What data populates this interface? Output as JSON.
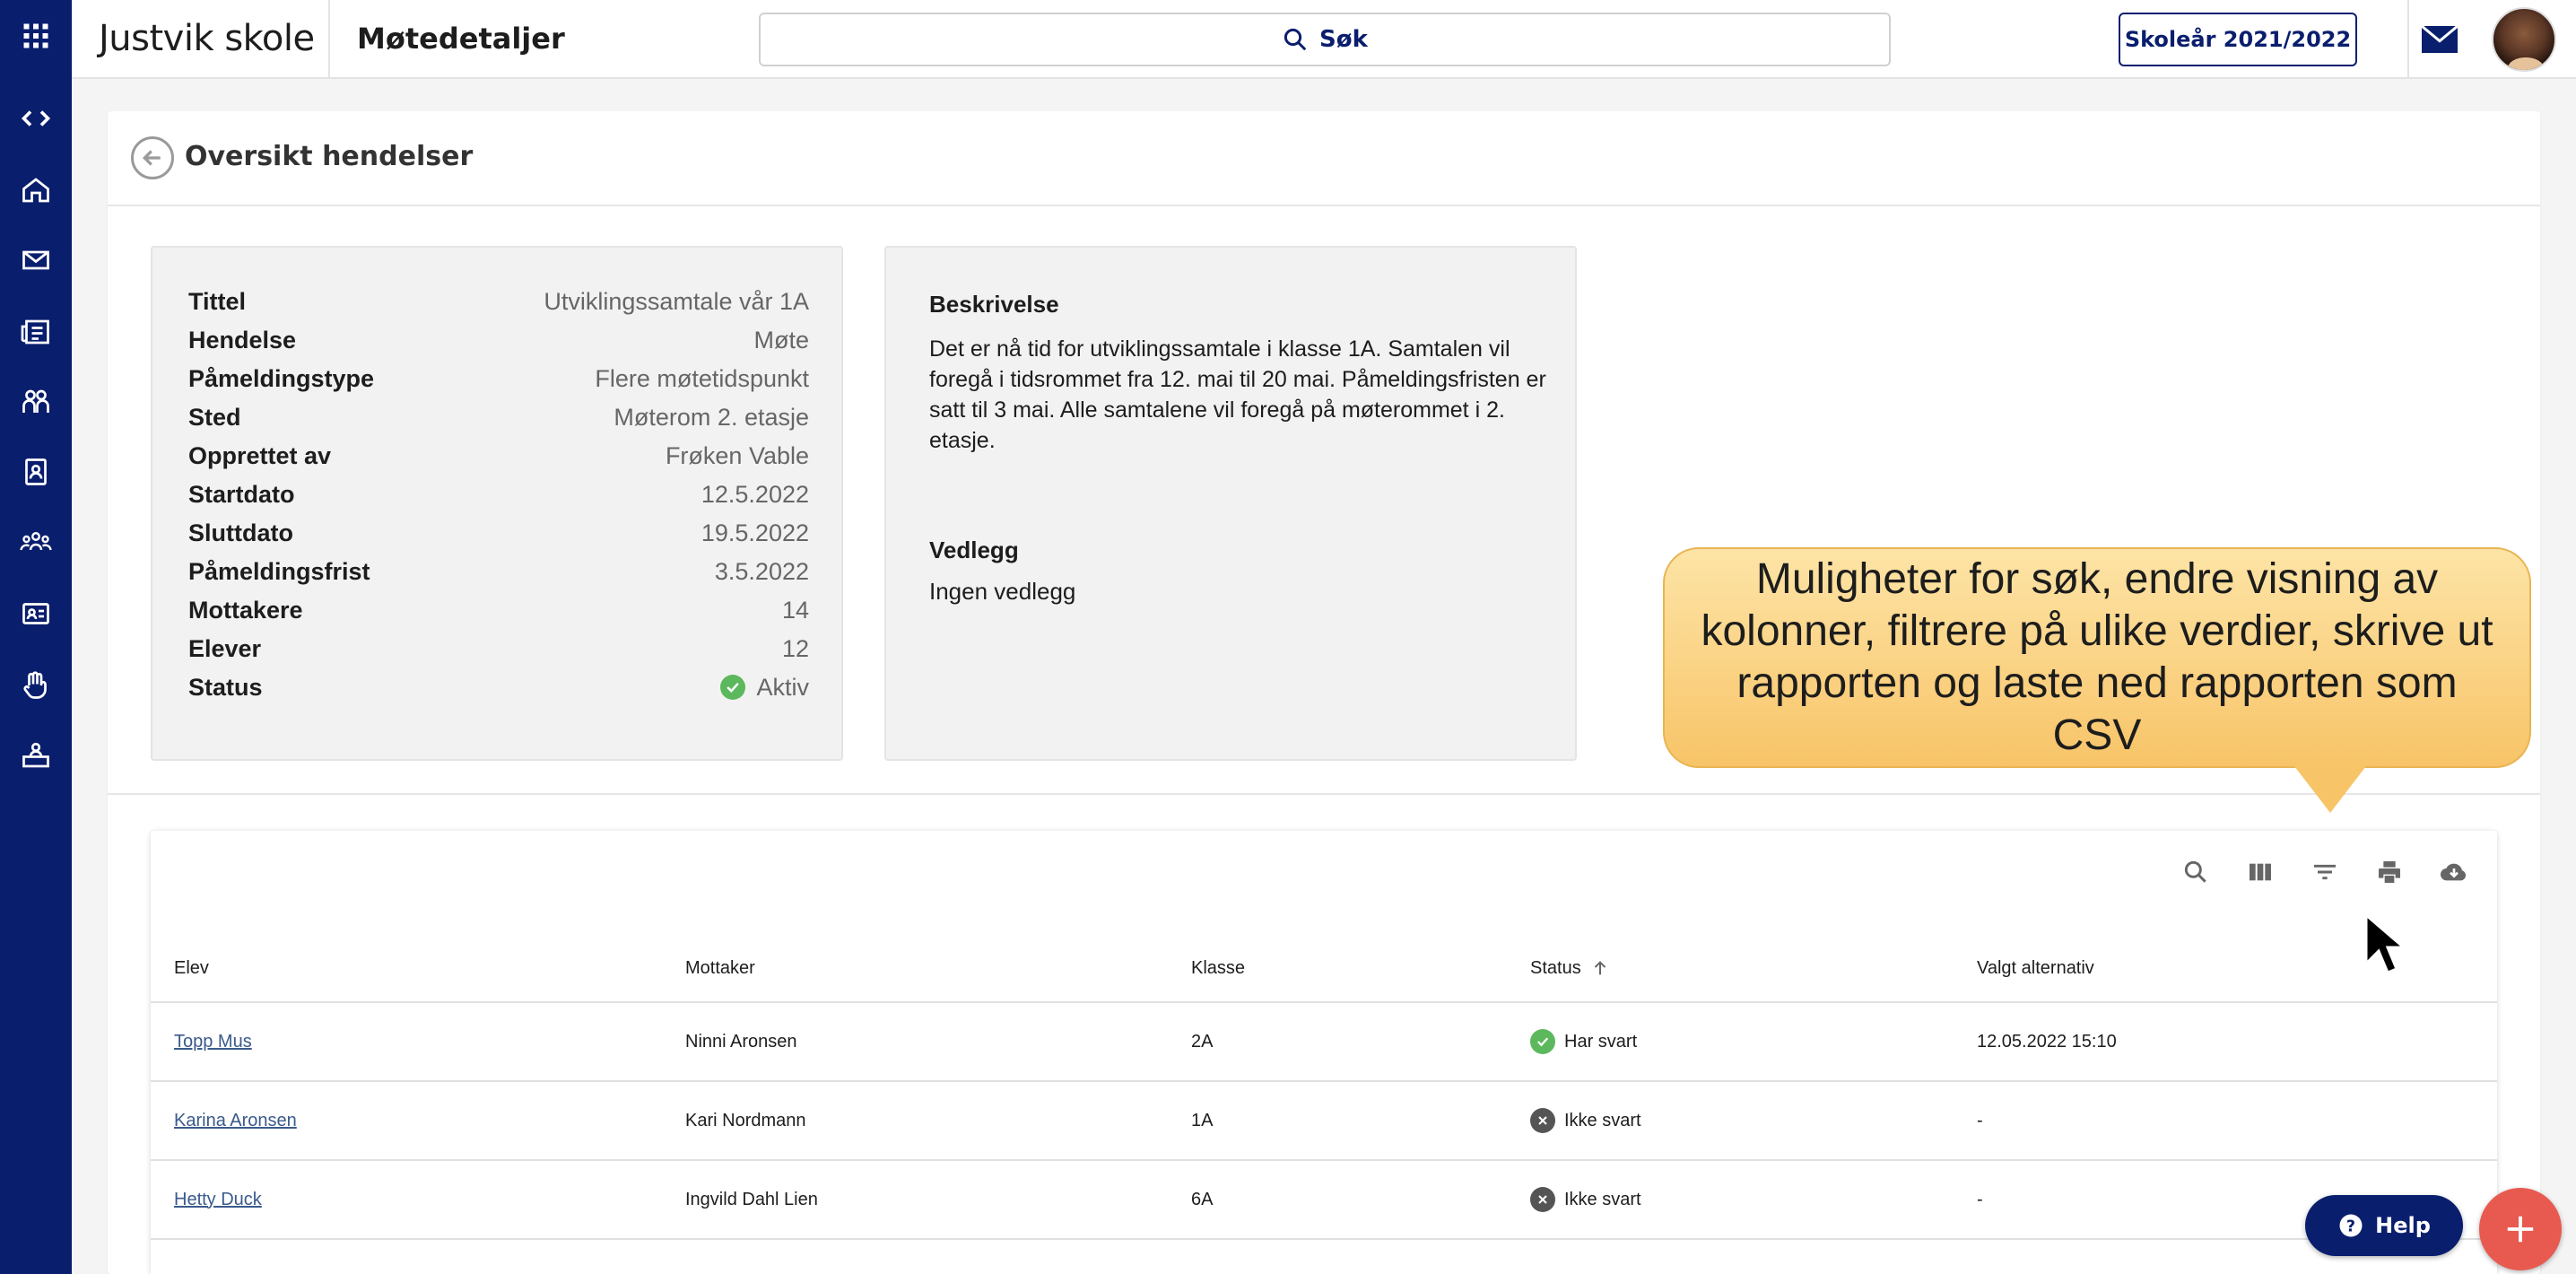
{
  "header": {
    "school_name": "Justvik skole",
    "page_title": "Møtedetaljer",
    "search_label": "Søk",
    "school_year": "Skoleår 2021/2022"
  },
  "back": {
    "label": "Oversikt hendelser"
  },
  "details": [
    {
      "key": "Tittel",
      "value": "Utviklingssamtale vår 1A"
    },
    {
      "key": "Hendelse",
      "value": "Møte"
    },
    {
      "key": "Påmeldingstype",
      "value": "Flere møtetidspunkt"
    },
    {
      "key": "Sted",
      "value": "Møterom 2. etasje"
    },
    {
      "key": "Opprettet av",
      "value": "Frøken Vable"
    },
    {
      "key": "Startdato",
      "value": "12.5.2022"
    },
    {
      "key": "Sluttdato",
      "value": "19.5.2022"
    },
    {
      "key": "Påmeldingsfrist",
      "value": "3.5.2022"
    },
    {
      "key": "Mottakere",
      "value": "14"
    },
    {
      "key": "Elever",
      "value": "12"
    },
    {
      "key": "Status",
      "value": "Aktiv"
    }
  ],
  "description": {
    "heading": "Beskrivelse",
    "text": "Det er nå tid for utviklingssamtale i klasse 1A. Samtalen vil foregå i tidsrommet fra 12. mai til 20 mai. Påmeldingsfristen er satt til 3 mai. Alle samtalene vil foregå på møterommet i 2. etasje.",
    "attachments_heading": "Vedlegg",
    "attachments_value": "Ingen vedlegg"
  },
  "callout": {
    "text": "Muligheter for søk, endre visning av kolonner, filtrere på ulike verdier, skrive ut rapporten og laste ned rapporten som CSV"
  },
  "table": {
    "columns": [
      "Elev",
      "Mottaker",
      "Klasse",
      "Status",
      "Valgt alternativ"
    ],
    "rows": [
      {
        "elev": "Topp Mus",
        "mottaker": "Ninni Aronsen",
        "klasse": "2A",
        "status": "Har svart",
        "valgt": "12.05.2022 15:10"
      },
      {
        "elev": "Karina Aronsen",
        "mottaker": "Kari Nordmann",
        "klasse": "1A",
        "status": "Ikke svart",
        "valgt": "-"
      },
      {
        "elev": "Hetty Duck",
        "mottaker": "Ingvild Dahl Lien",
        "klasse": "6A",
        "status": "Ikke svart",
        "valgt": "-"
      }
    ]
  },
  "help": {
    "label": "Help"
  },
  "colors": {
    "navy": "#0a1e6e",
    "status_ok": "#5cb85c",
    "status_no": "#555555",
    "fab": "#e85a4f",
    "callout": "#f8c468"
  }
}
